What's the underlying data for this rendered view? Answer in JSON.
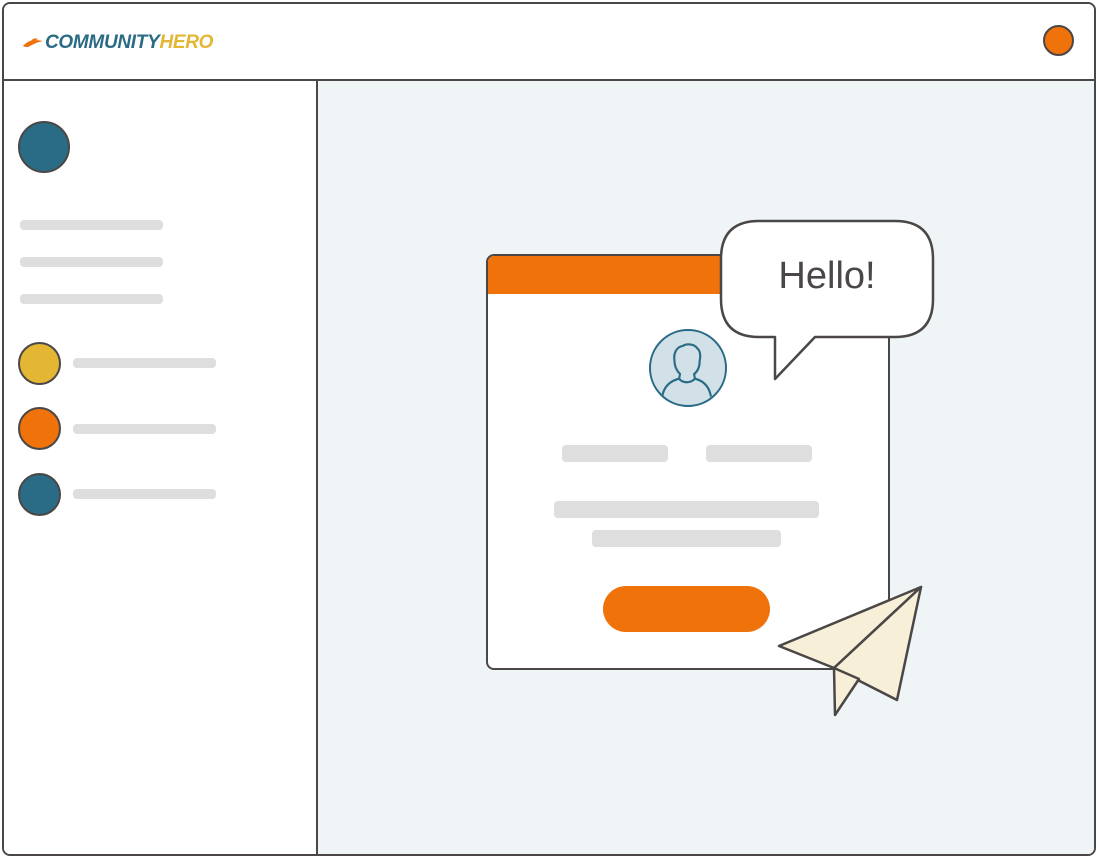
{
  "header": {
    "logo_part1": "COMMUNITY",
    "logo_part2": "HERO",
    "logo_icon": "bird-swoosh-icon",
    "profile_dot_color": "#ef720b"
  },
  "sidebar": {
    "avatar_color": "#2a6b85",
    "items": [
      {
        "icon": "circle-icon",
        "color": "#e3b634"
      },
      {
        "icon": "circle-icon",
        "color": "#ef720b"
      },
      {
        "icon": "circle-icon",
        "color": "#2a6b85"
      }
    ]
  },
  "card": {
    "accent_color": "#ef720b",
    "avatar_icon": "user-silhouette-icon",
    "speech_bubble_text": "Hello!",
    "decoration_icon": "paper-plane-icon"
  },
  "colors": {
    "accent": "#ef720b",
    "brand_teal": "#2a6b85",
    "brand_yellow": "#e3b634",
    "outline": "#4a4746",
    "background": "#eff4f7",
    "placeholder": "#dedede"
  }
}
